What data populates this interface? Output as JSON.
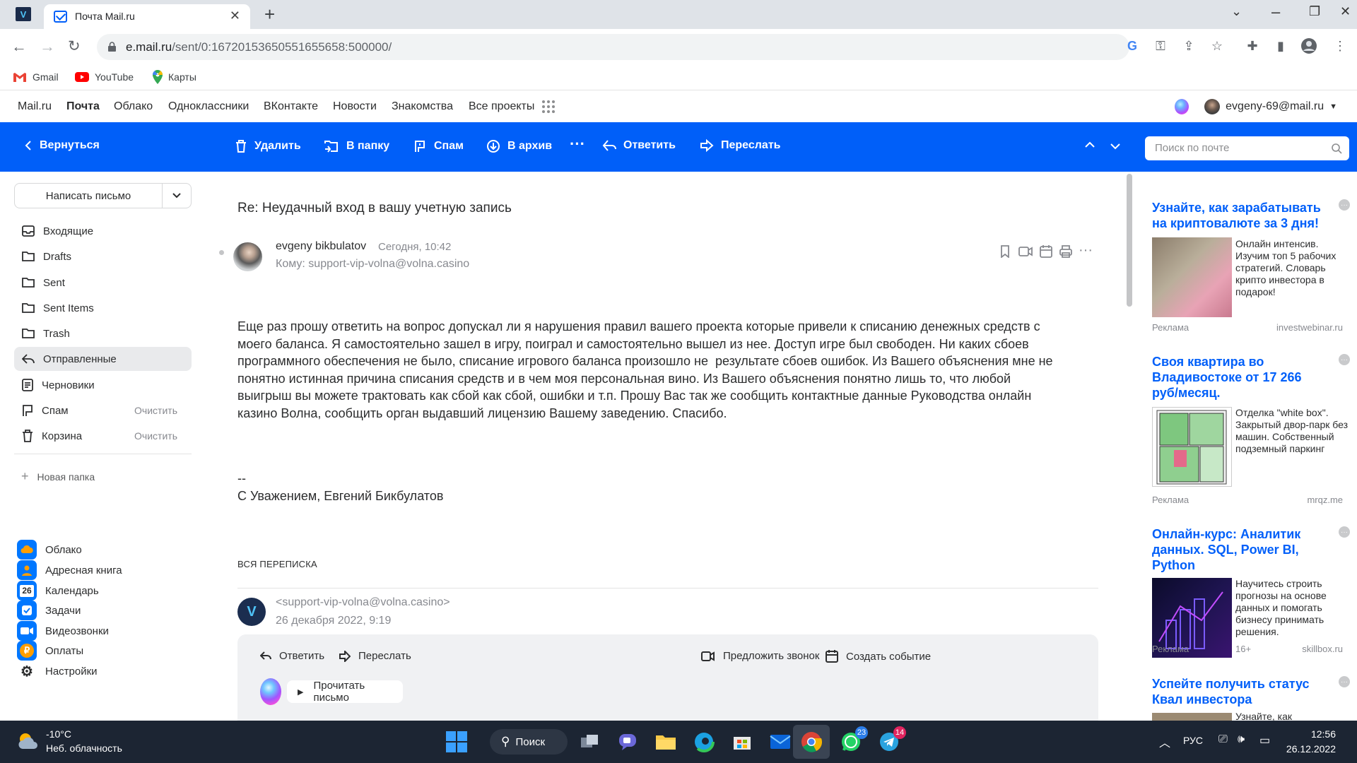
{
  "browser": {
    "tab_title": "Почта Mail.ru",
    "url_host": "e.mail.ru",
    "url_path": "/sent/0:16720153650551655658:500000/",
    "bookmarks": [
      "Gmail",
      "YouTube",
      "Карты"
    ]
  },
  "portal": {
    "links": [
      "Mail.ru",
      "Почта",
      "Облако",
      "Одноклассники",
      "ВКонтакте",
      "Новости",
      "Знакомства",
      "Все проекты"
    ],
    "user": "evgeny-69@mail.ru"
  },
  "toolbar": {
    "back": "Вернуться",
    "delete": "Удалить",
    "to_folder": "В папку",
    "spam": "Спам",
    "archive": "В архив",
    "reply": "Ответить",
    "forward": "Переслать",
    "search_placeholder": "Поиск по почте"
  },
  "sidebar": {
    "compose": "Написать письмо",
    "folders": [
      {
        "label": "Входящие",
        "icon": "inbox-icon"
      },
      {
        "label": "Drafts",
        "icon": "folder-icon"
      },
      {
        "label": "Sent",
        "icon": "folder-icon"
      },
      {
        "label": "Sent Items",
        "icon": "folder-icon"
      },
      {
        "label": "Trash",
        "icon": "folder-icon"
      },
      {
        "label": "Отправленные",
        "icon": "sent-icon"
      },
      {
        "label": "Черновики",
        "icon": "drafts-icon"
      },
      {
        "label": "Спам",
        "icon": "spam-icon",
        "action": "Очистить"
      },
      {
        "label": "Корзина",
        "icon": "trash-icon",
        "action": "Очистить"
      }
    ],
    "new_folder": "Новая папка",
    "apps": [
      {
        "label": "Облако",
        "color": "#0077ff"
      },
      {
        "label": "Адресная книга",
        "color": "#0077ff"
      },
      {
        "label": "Календарь",
        "color": "#0077ff",
        "day": "26"
      },
      {
        "label": "Задачи",
        "color": "#0077ff"
      },
      {
        "label": "Видеозвонки",
        "color": "#0077ff"
      },
      {
        "label": "Оплаты",
        "color": "#0077ff"
      },
      {
        "label": "Настройки",
        "color": "#2c2d2e"
      }
    ]
  },
  "message": {
    "subject": "Re: Неудачный вход в вашу учетную запись",
    "sender": "evgeny bikbulatov",
    "time": "Сегодня, 10:42",
    "to": "Кому: support-vip-volna@volna.casino",
    "body": [
      "Еще раз прошу ответить на вопрос допускал ли я нарушения правил вашего проекта которые привели к списанию денежных средств с",
      "моего баланса. Я самостоятельно зашел в игру, поиграл и самостоятельно вышел из нее. Доступ игре был свободен. Ни каких сбоев",
      "программного обеспечения не было, списание игрового баланса произошло не  результате сбоев ошибок. Из Вашего объяснения мне не",
      "понятно истинная причина списания средств и в чем моя персональная вино. Из Вашего объяснения понятно лишь то, что любой",
      "выигрыш вы можете трактовать как сбой как сбой, ошибки и т.п. Прошу Вас так же сообщить контактные данные Руководства онлайн",
      "казино Волна, сообщить орган выдавший лицензию Вашему заведению. Спасибо."
    ],
    "sig_dash": "--",
    "signature": "С Уважением, Евгений Бикбулатов",
    "thread_header": "ВСЯ ПЕРЕПИСКА",
    "thread_from": "<support-vip-volna@volna.casino>",
    "thread_date": "26 декабря 2022, 9:19",
    "thread_actions": {
      "reply": "Ответить",
      "forward": "Переслать",
      "call": "Предложить звонок",
      "event": "Создать событие",
      "read": "Прочитать письмо"
    }
  },
  "ads": [
    {
      "title": "Узнайте, как зарабатывать на криптовалюте за 3 дня!",
      "text": "Онлайн интенсив. Изучим топ 5 рабочих стратегий. Словарь крипто инвестора в подарок!",
      "label": "Реклама",
      "domain": "investwebinar.ru"
    },
    {
      "title": "Своя квартира во Владивостоке от 17 266 руб/месяц.",
      "text": "Отделка \"white box\". Закрытый двор-парк без машин. Собственный подземный паркинг",
      "label": "Реклама",
      "domain": "mrqz.me"
    },
    {
      "title": "Онлайн-курс: Аналитик данных. SQL, Power BI, Python",
      "text": "Научитесь строить прогнозы на основе данных и помогать бизнесу принимать решения.",
      "label": "Реклама",
      "age": "16+",
      "domain": "skillbox.ru"
    },
    {
      "title": "Успейте получить статус Квал инвестора",
      "text": "Узнайте, как"
    }
  ],
  "taskbar": {
    "temp": "-10°C",
    "weather": "Неб. облачность",
    "search": "Поиск",
    "lang": "РУС",
    "time": "12:56",
    "date": "26.12.2022",
    "whatsapp_badge": "23",
    "telegram_badge": "14"
  }
}
